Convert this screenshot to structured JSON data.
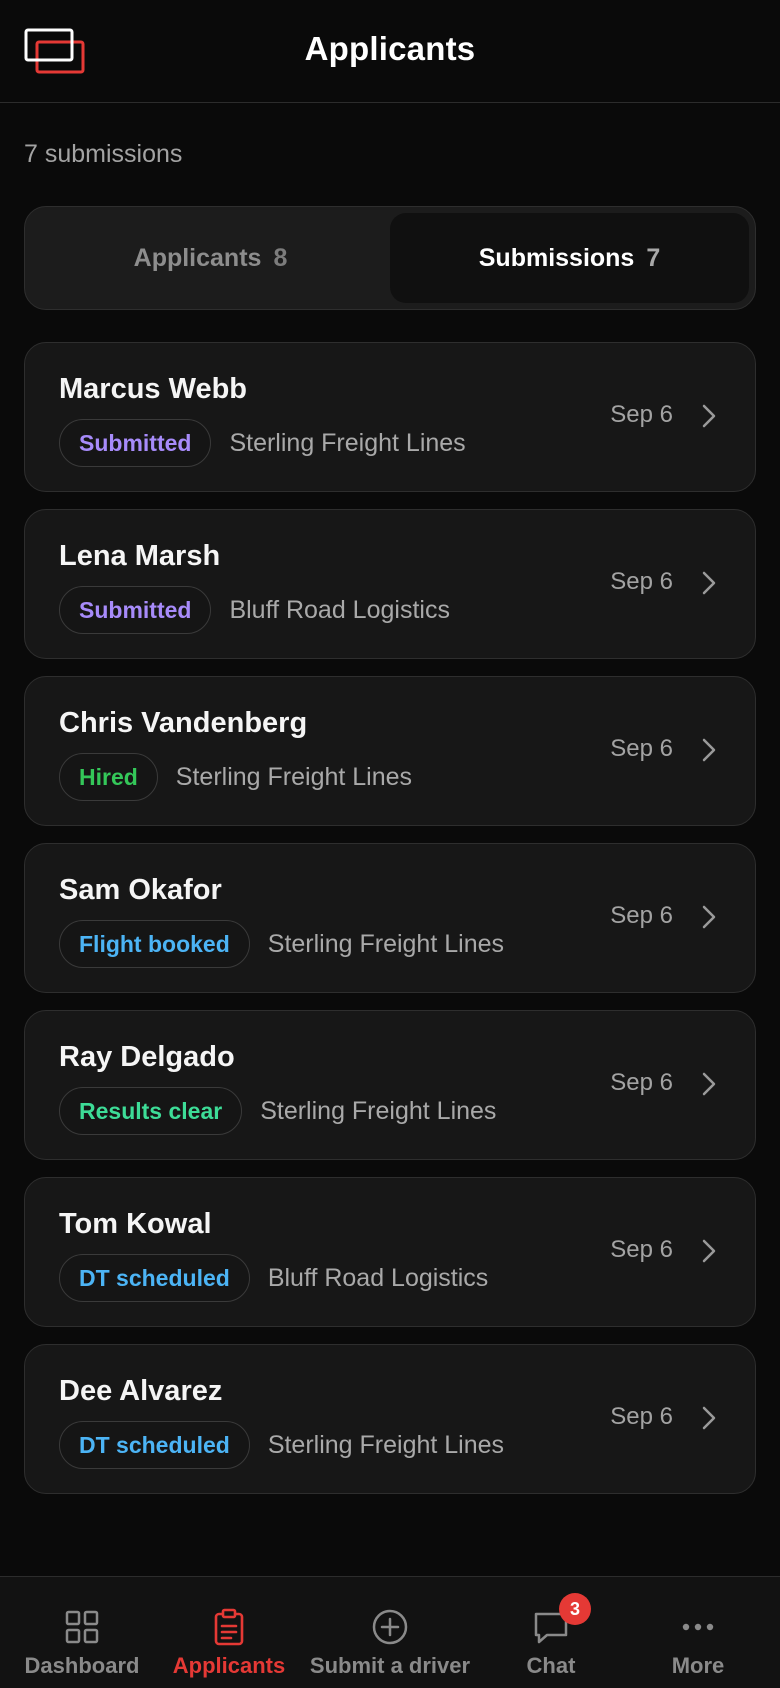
{
  "header": {
    "title": "Applicants",
    "logo_icon": "app-logo-icon"
  },
  "summary": {
    "count_text": "7 submissions"
  },
  "segments": [
    {
      "label": "Applicants",
      "count": "8",
      "active": false
    },
    {
      "label": "Submissions",
      "count": "7",
      "active": true
    }
  ],
  "status_colors": {
    "Submitted": "#a78bfa",
    "Hired": "#34c759",
    "Flight booked": "#4cb4f5",
    "Results clear": "#3ddc97",
    "DT scheduled": "#4cb4f5"
  },
  "submissions": [
    {
      "name": "Marcus Webb",
      "status": "Submitted",
      "company": "Sterling Freight Lines",
      "date": "Sep 6"
    },
    {
      "name": "Lena Marsh",
      "status": "Submitted",
      "company": "Bluff Road Logistics",
      "date": "Sep 6"
    },
    {
      "name": "Chris Vandenberg",
      "status": "Hired",
      "company": "Sterling Freight Lines",
      "date": "Sep 6"
    },
    {
      "name": "Sam Okafor",
      "status": "Flight booked",
      "company": "Sterling Freight Lines",
      "date": "Sep 6"
    },
    {
      "name": "Ray Delgado",
      "status": "Results clear",
      "company": "Sterling Freight Lines",
      "date": "Sep 6"
    },
    {
      "name": "Tom Kowal",
      "status": "DT scheduled",
      "company": "Bluff Road Logistics",
      "date": "Sep 6"
    },
    {
      "name": "Dee Alvarez",
      "status": "DT scheduled",
      "company": "Sterling Freight Lines",
      "date": "Sep 6"
    }
  ],
  "nav": {
    "items": [
      {
        "label": "Dashboard",
        "icon": "dashboard-grid-icon",
        "active": false
      },
      {
        "label": "Applicants",
        "icon": "clipboard-icon",
        "active": true
      },
      {
        "label": "Submit a driver",
        "icon": "plus-circle-icon",
        "active": false
      },
      {
        "label": "Chat",
        "icon": "chat-bubble-icon",
        "active": false,
        "badge": "3"
      },
      {
        "label": "More",
        "icon": "more-dots-icon",
        "active": false
      }
    ]
  },
  "colors": {
    "accent": "#e53935",
    "background": "#0a0a0a",
    "card": "#171717"
  }
}
